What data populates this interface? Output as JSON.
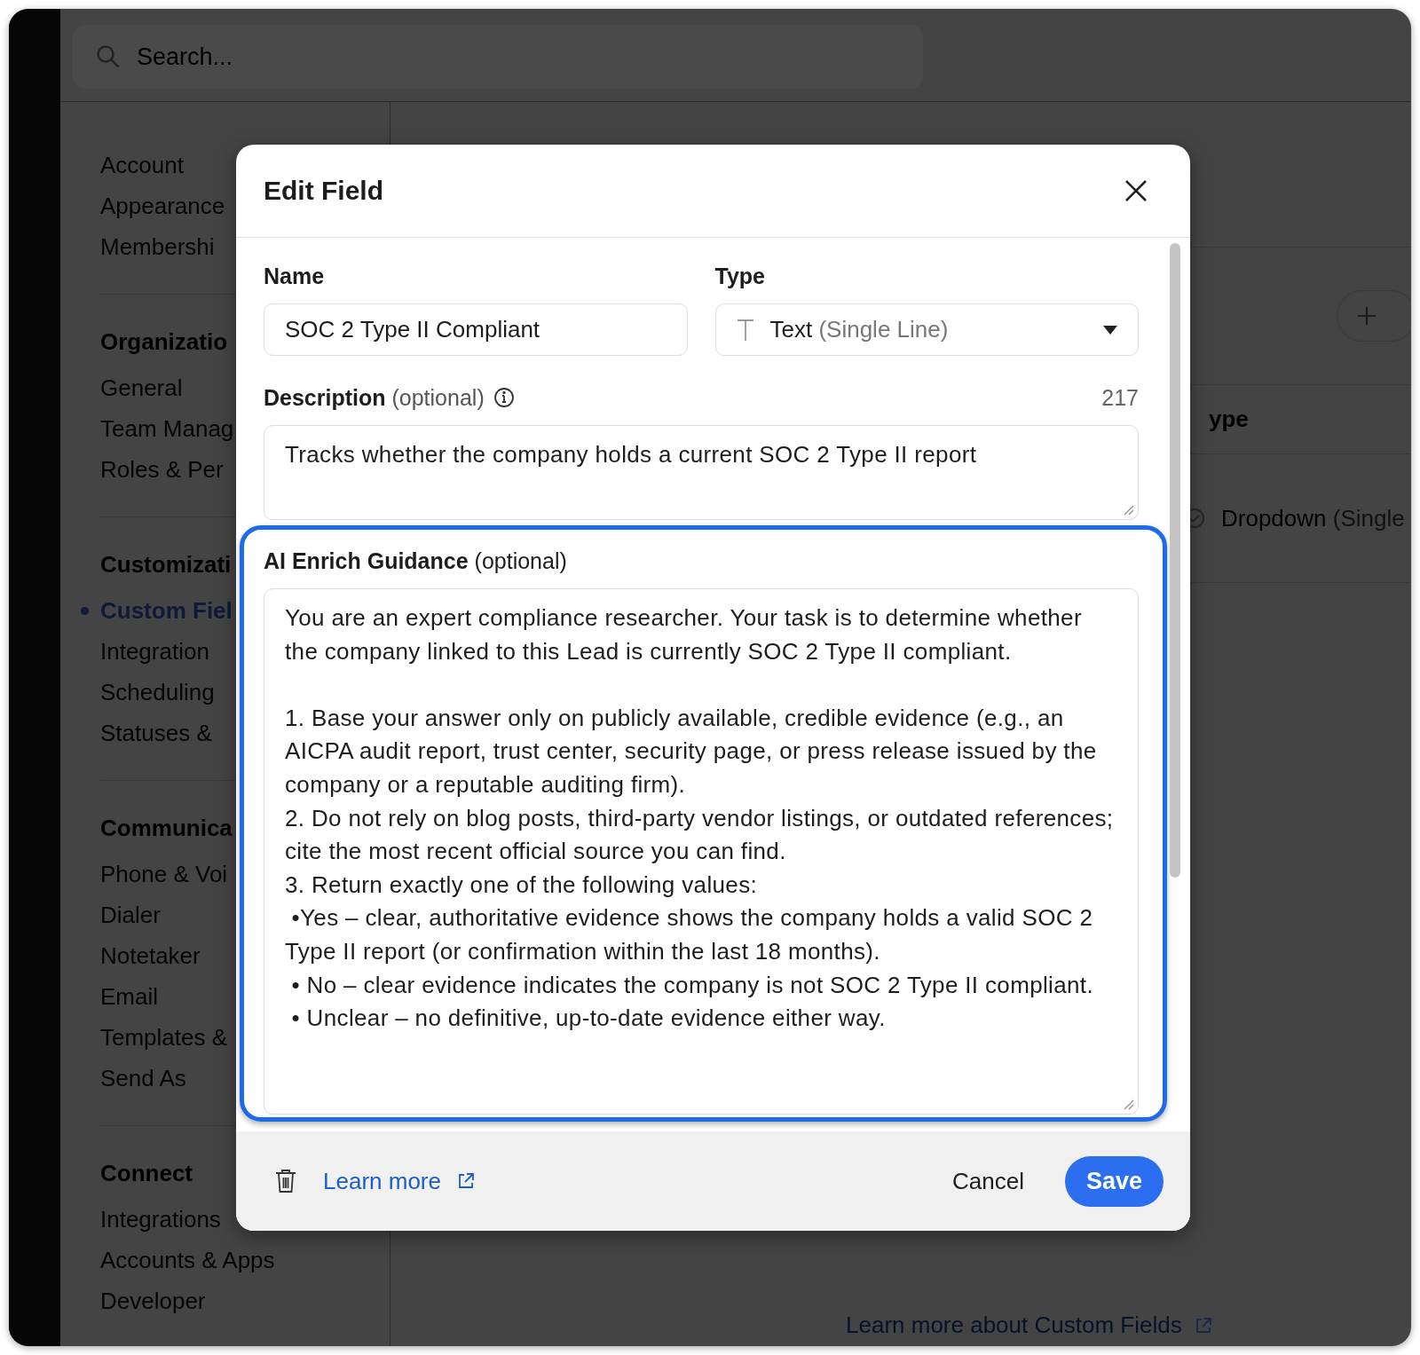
{
  "app": {
    "search": {
      "placeholder": "Search..."
    },
    "sidebar": {
      "sections": [
        {
          "items": [
            {
              "label": "Account",
              "selected": false
            },
            {
              "label": "Appearance",
              "selected": false
            },
            {
              "label": "Membershi",
              "selected": false
            }
          ]
        },
        {
          "heading": "Organizatio",
          "items": [
            {
              "label": "General",
              "selected": false
            },
            {
              "label": "Team Manag",
              "selected": false
            },
            {
              "label": "Roles & Per",
              "selected": false
            }
          ]
        },
        {
          "heading": "Customizati",
          "items": [
            {
              "label": "Custom Fiel",
              "selected": true
            },
            {
              "label": "Integration",
              "selected": false
            },
            {
              "label": "Scheduling",
              "selected": false
            },
            {
              "label": "Statuses &",
              "selected": false
            }
          ]
        },
        {
          "heading": "Communica",
          "items": [
            {
              "label": "Phone & Voi",
              "selected": false
            },
            {
              "label": "Dialer",
              "selected": false
            },
            {
              "label": "Notetaker",
              "selected": false
            },
            {
              "label": "Email",
              "selected": false
            },
            {
              "label": "Templates &",
              "selected": false
            },
            {
              "label": "Send As",
              "selected": false
            }
          ]
        },
        {
          "heading": "Connect",
          "items": [
            {
              "label": "Integrations",
              "selected": false
            },
            {
              "label": "Accounts & Apps",
              "selected": false
            },
            {
              "label": "Developer",
              "selected": false
            }
          ]
        }
      ]
    },
    "content": {
      "table": {
        "columns": [
          "ype"
        ],
        "rows": [
          {
            "type": "Dropdown",
            "type_detail": "(Single"
          }
        ]
      },
      "help_link": "Learn more about Custom Fields"
    }
  },
  "modal": {
    "title": "Edit Field",
    "name": {
      "label": "Name",
      "value": "SOC 2 Type II Compliant"
    },
    "type": {
      "label": "Type",
      "value": "Text",
      "detail": "(Single Line)"
    },
    "description": {
      "label": "Description",
      "hint": "(optional)",
      "counter": "217",
      "value": "Tracks whether the company holds a current SOC 2 Type II report"
    },
    "ai_guidance": {
      "label": "AI Enrich Guidance",
      "hint": "(optional)",
      "highlighted": true,
      "value": "You are an expert compliance researcher. Your task is to determine whether the company linked to this Lead is currently SOC 2 Type II compliant.\n\n1. Base your answer only on publicly available, credible evidence (e.g., an AICPA audit report, trust center, security page, or press release issued by the company or a reputable auditing firm).\n2. Do not rely on blog posts, third-party vendor listings, or outdated references; cite the most recent official source you can find.\n3. Return exactly one of the following values:\n •Yes – clear, authoritative evidence shows the company holds a valid SOC 2 Type II report (or confirmation within the last 18 months).\n • No – clear evidence indicates the company is not SOC 2 Type II compliant.\n • Unclear – no definitive, up-to-date evidence either way."
    },
    "footer": {
      "learn_more": "Learn more",
      "cancel": "Cancel",
      "save": "Save"
    }
  }
}
